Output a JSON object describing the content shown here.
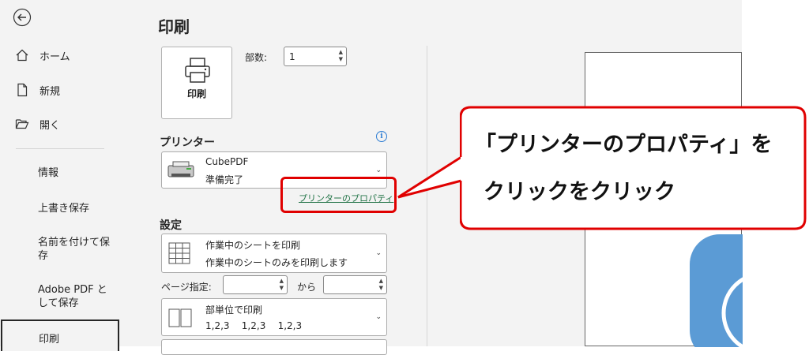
{
  "sidebar": {
    "back_label": "戻る",
    "items": [
      {
        "label": "ホーム",
        "icon": "home-icon"
      },
      {
        "label": "新規",
        "icon": "new-document-icon"
      },
      {
        "label": "開く",
        "icon": "open-folder-icon"
      }
    ],
    "text_items": [
      {
        "label": "情報"
      },
      {
        "label": "上書き保存"
      },
      {
        "label": "名前を付けて保存"
      },
      {
        "label": "Adobe PDF として保存"
      },
      {
        "label": "印刷"
      }
    ]
  },
  "main": {
    "title": "印刷",
    "print_button_label": "印刷",
    "copies_label": "部数:",
    "copies_value": "1",
    "printer_section": "プリンター",
    "printer_name": "CubePDF",
    "printer_status": "準備完了",
    "printer_properties_link": "プリンターのプロパティ",
    "settings_section": "設定",
    "setting_scope_title": "作業中のシートを印刷",
    "setting_scope_desc": "作業中のシートのみを印刷します",
    "pages_label": "ページ指定:",
    "pages_from_value": "",
    "pages_to_label": "から",
    "pages_to_value": "",
    "collate_title": "部単位で印刷",
    "collate_desc": "1,2,3    1,2,3    1,2,3"
  },
  "callout": {
    "line1": "「プリンターのプロパティ」を",
    "line2": "クリックをクリック"
  },
  "colors": {
    "highlight_red": "#e00000",
    "link_green": "#217346",
    "preview_blue": "#5b9bd5"
  }
}
